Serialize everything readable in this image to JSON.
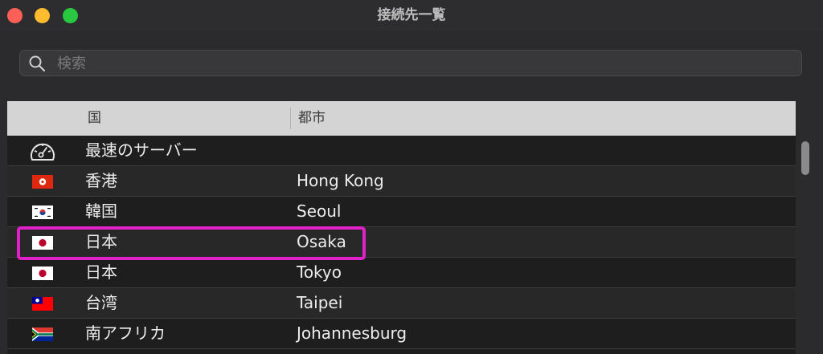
{
  "window": {
    "title": "接続先一覧"
  },
  "search": {
    "placeholder": "検索",
    "value": ""
  },
  "table": {
    "columns": {
      "country": "国",
      "city": "都市"
    },
    "rows": [
      {
        "icon": "speedometer-icon",
        "country": "最速のサーバー",
        "city": ""
      },
      {
        "icon": "flag-hong-kong-icon",
        "country": "香港",
        "city": "Hong Kong"
      },
      {
        "icon": "flag-south-korea-icon",
        "country": "韓国",
        "city": "Seoul"
      },
      {
        "icon": "flag-japan-icon",
        "country": "日本",
        "city": "Osaka",
        "highlighted": true
      },
      {
        "icon": "flag-japan-icon",
        "country": "日本",
        "city": "Tokyo"
      },
      {
        "icon": "flag-taiwan-icon",
        "country": "台湾",
        "city": "Taipei"
      },
      {
        "icon": "flag-south-africa-icon",
        "country": "南アフリカ",
        "city": "Johannesburg"
      }
    ]
  },
  "colors": {
    "highlight": "#e020c8",
    "header_bg": "#d4d4d4",
    "window_bg": "#2b2b2d"
  }
}
